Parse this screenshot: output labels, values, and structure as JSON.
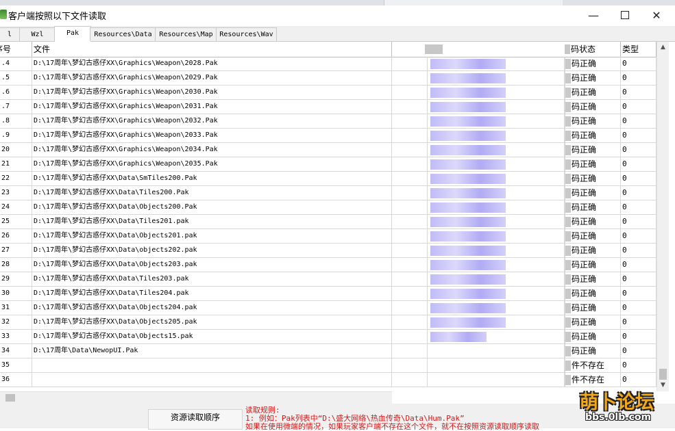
{
  "window": {
    "title": "客户端按照以下文件读取",
    "minimize_glyph": "—",
    "close_glyph": "✕"
  },
  "tabs": [
    {
      "label": "l"
    },
    {
      "label": "Wzl"
    },
    {
      "label": "Pak"
    },
    {
      "label": "Resources\\Data"
    },
    {
      "label": "Resources\\Map"
    },
    {
      "label": "Resources\\Wav"
    }
  ],
  "table": {
    "headers": {
      "index": "序号",
      "file": "文件",
      "status": "码状态",
      "type": "类型"
    },
    "rows": [
      {
        "index": ".4",
        "file": "D:\\17周年\\梦幻古惑仔XX\\Graphics\\Weapon\\2028.Pak",
        "status": "码正确",
        "type": "0",
        "blur": true
      },
      {
        "index": ".5",
        "file": "D:\\17周年\\梦幻古惑仔XX\\Graphics\\Weapon\\2029.Pak",
        "status": "码正确",
        "type": "0",
        "blur": true
      },
      {
        "index": ".6",
        "file": "D:\\17周年\\梦幻古惑仔XX\\Graphics\\Weapon\\2030.Pak",
        "status": "码正确",
        "type": "0",
        "blur": true
      },
      {
        "index": ".7",
        "file": "D:\\17周年\\梦幻古惑仔XX\\Graphics\\Weapon\\2031.Pak",
        "status": "码正确",
        "type": "0",
        "blur": true
      },
      {
        "index": ".8",
        "file": "D:\\17周年\\梦幻古惑仔XX\\Graphics\\Weapon\\2032.Pak",
        "status": "码正确",
        "type": "0",
        "blur": true
      },
      {
        "index": ".9",
        "file": "D:\\17周年\\梦幻古惑仔XX\\Graphics\\Weapon\\2033.Pak",
        "status": "码正确",
        "type": "0",
        "blur": true
      },
      {
        "index": "20",
        "file": "D:\\17周年\\梦幻古惑仔XX\\Graphics\\Weapon\\2034.Pak",
        "status": "码正确",
        "type": "0",
        "blur": true
      },
      {
        "index": "21",
        "file": "D:\\17周年\\梦幻古惑仔XX\\Graphics\\Weapon\\2035.Pak",
        "status": "码正确",
        "type": "0",
        "blur": true
      },
      {
        "index": "22",
        "file": "D:\\17周年\\梦幻古惑仔XX\\Data\\SmTiles200.Pak",
        "status": "码正确",
        "type": "0",
        "blur": true
      },
      {
        "index": "23",
        "file": "D:\\17周年\\梦幻古惑仔XX\\Data\\Tiles200.Pak",
        "status": "码正确",
        "type": "0",
        "blur": true
      },
      {
        "index": "24",
        "file": "D:\\17周年\\梦幻古惑仔XX\\Data\\Objects200.Pak",
        "status": "码正确",
        "type": "0",
        "blur": true
      },
      {
        "index": "25",
        "file": "D:\\17周年\\梦幻古惑仔XX\\Data\\Tiles201.pak",
        "status": "码正确",
        "type": "0",
        "blur": true
      },
      {
        "index": "26",
        "file": "D:\\17周年\\梦幻古惑仔XX\\Data\\Objects201.pak",
        "status": "码正确",
        "type": "0",
        "blur": true
      },
      {
        "index": "27",
        "file": "D:\\17周年\\梦幻古惑仔XX\\Data\\objects202.pak",
        "status": "码正确",
        "type": "0",
        "blur": true
      },
      {
        "index": "28",
        "file": "D:\\17周年\\梦幻古惑仔XX\\Data\\Objects203.pak",
        "status": "码正确",
        "type": "0",
        "blur": true
      },
      {
        "index": "29",
        "file": "D:\\17周年\\梦幻古惑仔XX\\Data\\Tiles203.pak",
        "status": "码正确",
        "type": "0",
        "blur": true
      },
      {
        "index": "30",
        "file": "D:\\17周年\\梦幻古惑仔XX\\Data\\Tiles204.pak",
        "status": "码正确",
        "type": "0",
        "blur": true
      },
      {
        "index": "31",
        "file": "D:\\17周年\\梦幻古惑仔XX\\Data\\Objects204.pak",
        "status": "码正确",
        "type": "0",
        "blur": true
      },
      {
        "index": "32",
        "file": "D:\\17周年\\梦幻古惑仔XX\\Data\\Objects205.pak",
        "status": "码正确",
        "type": "0",
        "blur": true
      },
      {
        "index": "33",
        "file": "D:\\17周年\\梦幻古惑仔XX\\Data\\Objects15.pak",
        "status": "码正确",
        "type": "0",
        "blur": true
      },
      {
        "index": "34",
        "file": "D:\\17周年\\Data\\NewopUI.Pak",
        "status": "码正确",
        "type": "0",
        "blur": false
      },
      {
        "index": "35",
        "file": "",
        "status": "件不存在",
        "type": "0",
        "blur": false
      },
      {
        "index": "36",
        "file": "",
        "status": "件不存在",
        "type": "0",
        "blur": false
      }
    ]
  },
  "bottom": {
    "resource_order_label": "资源读取顺序",
    "rules_title": "读取规则:",
    "rules_line1": "1: 例如：Pak列表中“D:\\盛大网络\\热血传奇\\Data\\Hum.Pak”",
    "rules_line2": "   如果在使用微端的情况，如果玩家客户端不存在这个文件，就不在按照资源读取顺序读取"
  },
  "watermark": {
    "title": "萌卜论坛",
    "url": "bbs.0lb.com"
  },
  "colors": {
    "status_text": "#000000",
    "rules_text": "#d31a1a",
    "watermark_orange": "#f2a81a"
  }
}
